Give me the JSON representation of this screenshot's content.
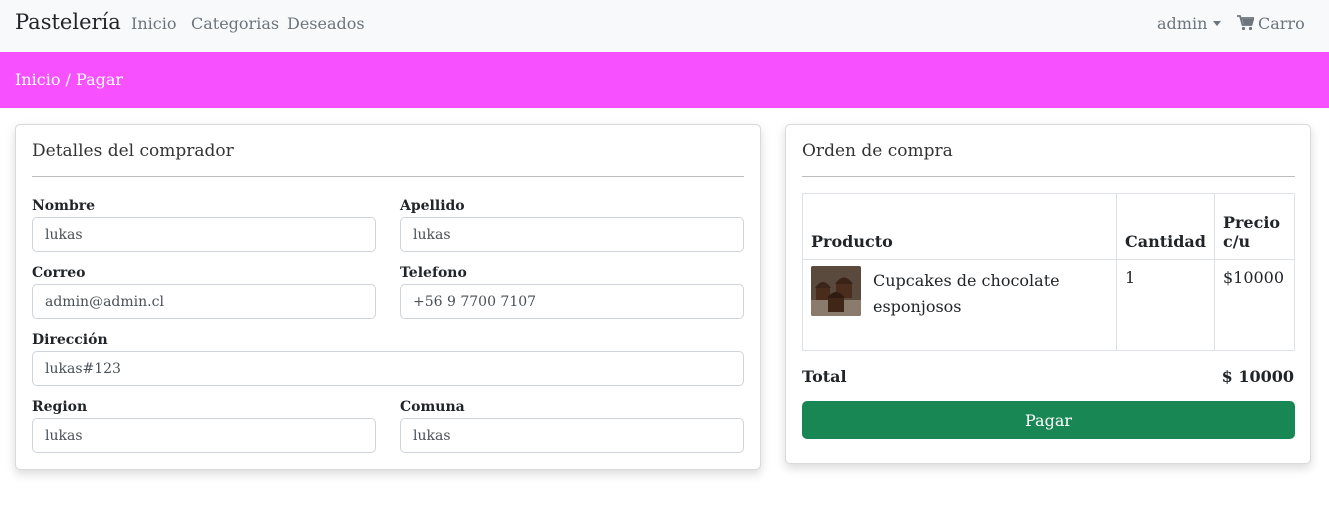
{
  "navbar": {
    "brand": "Pastelería",
    "links": [
      "Inicio",
      "Categorias",
      "Deseados"
    ],
    "user": "admin",
    "cart": "Carro"
  },
  "breadcrumb": "Inicio / Pagar",
  "buyer": {
    "title": "Detalles del comprador",
    "fields": {
      "nombre": {
        "label": "Nombre",
        "value": "lukas"
      },
      "apellido": {
        "label": "Apellido",
        "value": "lukas"
      },
      "correo": {
        "label": "Correo",
        "value": "admin@admin.cl"
      },
      "telefono": {
        "label": "Telefono",
        "value": "+56 9 7700 7107"
      },
      "direccion": {
        "label": "Dirección",
        "value": "lukas#123"
      },
      "region": {
        "label": "Region",
        "value": "lukas"
      },
      "comuna": {
        "label": "Comuna",
        "value": "lukas"
      }
    }
  },
  "order": {
    "title": "Orden de compra",
    "columns": [
      "Producto",
      "Cantidad",
      "Precio c/u"
    ],
    "rows": [
      {
        "product": "Cupcakes de chocolate esponjosos",
        "quantity": "1",
        "price": "$10000"
      }
    ],
    "total_label": "Total",
    "total_value": "$ 10000",
    "pay_button": "Pagar"
  },
  "colors": {
    "breadcrumb_bg": "#f750ff",
    "pay_button": "#198754",
    "navbar_bg": "#f8f9fa"
  },
  "icons": [
    "cart-icon",
    "caret-down-icon",
    "product-thumbnail"
  ]
}
